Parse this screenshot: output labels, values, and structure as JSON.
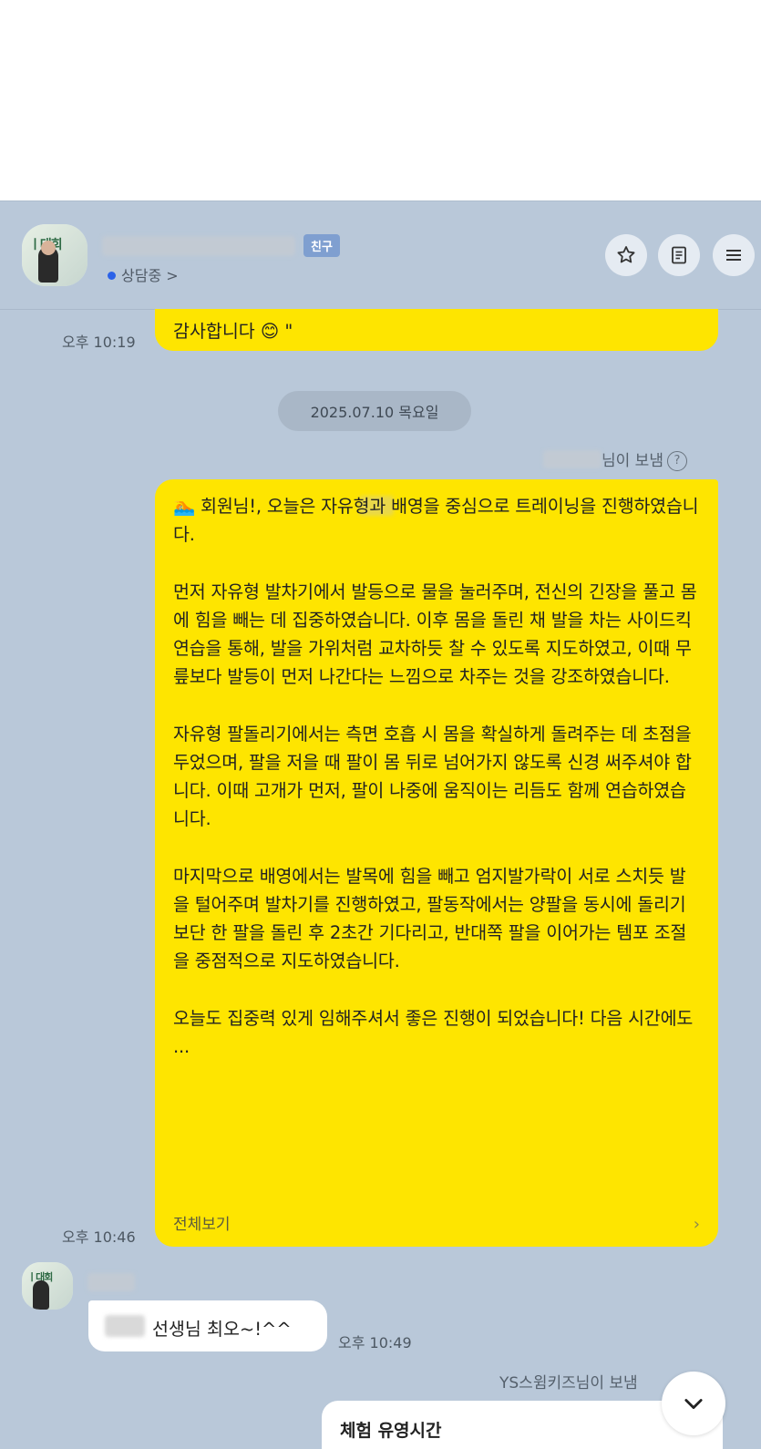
{
  "header": {
    "badge": "친구",
    "status": "상담중 >"
  },
  "messages": {
    "prev_time": "오후 10:19",
    "prev_text": "감사합니다 😊 \"",
    "date": "2025.07.10 목요일",
    "sent_by_suffix": "님이 보냄",
    "main_text": "🏊 회원님!, 오늘은 자유형과 배영을 중심으로 트레이닝을 진행하였습니다.\n\n먼저 자유형 발차기에서 발등으로 물을 눌러주며, 전신의 긴장을 풀고 몸에 힘을 빼는 데 집중하였습니다. 이후 몸을 돌린 채 발을 차는 사이드킥 연습을 통해, 발을 가위처럼 교차하듯 찰 수 있도록 지도하였고, 이때 무릎보다 발등이 먼저 나간다는 느낌으로 차주는 것을 강조하였습니다.\n\n자유형 팔돌리기에서는 측면 호흡 시 몸을 확실하게 돌려주는 데 초점을 두었으며, 팔을 저을 때 팔이 몸 뒤로 넘어가지 않도록 신경 써주셔야 합니다. 이때 고개가 먼저, 팔이 나중에 움직이는 리듬도 함께 연습하였습니다.\n\n마지막으로 배영에서는 발목에 힘을 빼고 엄지발가락이 서로 스치듯 발을 털어주며 발차기를 진행하였고, 팔동작에서는 양팔을 동시에 돌리기보단 한 팔을 돌린 후 2초간 기다리고, 반대쪽 팔을 이어가는 템포 조절을 중점적으로 지도하였습니다.\n\n오늘도 집중력 있게 임해주셔서 좋은 진행이 되었습니다! 다음 시간에도 ...",
    "view_all": "전체보기",
    "main_time": "오후 10:46",
    "reply_text": "선생님 최오~!^^",
    "reply_time": "오후 10:49",
    "next_sender": "YS스윔키즈님이 보냄",
    "next_preview": "체험 유영시간"
  },
  "icons": {
    "star": "star-icon",
    "notes": "notes-icon",
    "menu": "menu-icon",
    "scroll": "chevron-down-icon",
    "help": "question-icon"
  },
  "colors": {
    "chat_bg": "#b9c8d9",
    "my_bubble": "#fee500",
    "badge": "#7f9fd0",
    "status_dot": "#2b62e8"
  }
}
